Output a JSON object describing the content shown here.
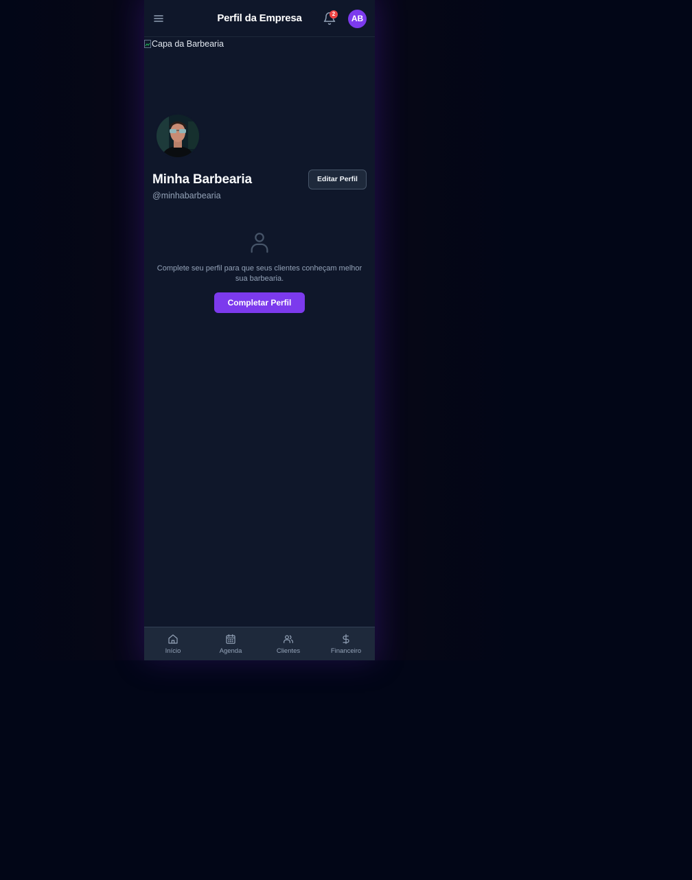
{
  "header": {
    "title": "Perfil da Empresa",
    "notification_count": "2",
    "avatar_initials": "AB",
    "menu_icon": "menu-icon",
    "bell_icon": "bell-icon"
  },
  "cover": {
    "alt_text": "Capa da Barbearia"
  },
  "profile": {
    "name": "Minha Barbearia",
    "handle": "@minhabarbearia",
    "edit_label": "Editar Perfil"
  },
  "empty_state": {
    "icon": "user-icon",
    "message": "Complete seu perfil para que seus clientes conheçam melhor sua barbearia.",
    "button_label": "Completar Perfil"
  },
  "bottom_nav": {
    "items": [
      {
        "label": "Início",
        "icon": "home-icon"
      },
      {
        "label": "Agenda",
        "icon": "calendar-icon"
      },
      {
        "label": "Clientes",
        "icon": "users-icon"
      },
      {
        "label": "Financeiro",
        "icon": "dollar-icon"
      }
    ]
  },
  "colors": {
    "accent": "#7c3aed",
    "badge": "#ef4444",
    "panel": "#0f172a",
    "nav_background": "#1e293b",
    "page_background": "#020617"
  }
}
